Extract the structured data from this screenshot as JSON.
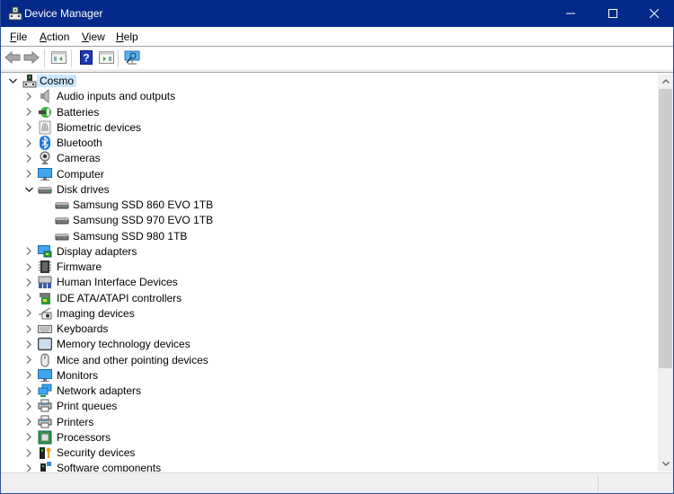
{
  "window": {
    "title": "Device Manager",
    "controls": {
      "minimize": "minimize",
      "maximize": "maximize",
      "close": "close"
    }
  },
  "menubar": {
    "items": [
      {
        "label": "File",
        "accel": "F",
        "rest": "ile"
      },
      {
        "label": "Action",
        "accel": "A",
        "rest": "ction"
      },
      {
        "label": "View",
        "accel": "V",
        "rest": "iew"
      },
      {
        "label": "Help",
        "accel": "H",
        "rest": "elp"
      }
    ]
  },
  "toolbar": {
    "buttons": [
      {
        "name": "back",
        "icon": "arrow-left-icon"
      },
      {
        "name": "forward",
        "icon": "arrow-right-icon"
      },
      {
        "name": "show-hide-console-tree",
        "icon": "console-tree-icon"
      },
      {
        "name": "help",
        "icon": "help-icon"
      },
      {
        "name": "show-hide-action-pane",
        "icon": "action-pane-icon"
      },
      {
        "name": "scan-hardware-changes",
        "icon": "scan-monitor-icon"
      }
    ]
  },
  "tree": {
    "root": {
      "label": "Cosmo",
      "expanded": true,
      "selected": true,
      "icon": "computer-tower-icon"
    },
    "categories": [
      {
        "label": "Audio inputs and outputs",
        "icon": "speaker-icon",
        "expanded": false
      },
      {
        "label": "Batteries",
        "icon": "battery-plug-icon",
        "expanded": false
      },
      {
        "label": "Biometric devices",
        "icon": "fingerprint-icon",
        "expanded": false
      },
      {
        "label": "Bluetooth",
        "icon": "bluetooth-icon",
        "expanded": false
      },
      {
        "label": "Cameras",
        "icon": "webcam-icon",
        "expanded": false
      },
      {
        "label": "Computer",
        "icon": "monitor-icon",
        "expanded": false
      },
      {
        "label": "Disk drives",
        "icon": "disk-drive-icon",
        "expanded": true,
        "children": [
          {
            "label": "Samsung SSD 860 EVO 1TB",
            "icon": "disk-drive-icon"
          },
          {
            "label": "Samsung SSD 970 EVO 1TB",
            "icon": "disk-drive-icon"
          },
          {
            "label": "Samsung SSD 980 1TB",
            "icon": "disk-drive-icon"
          }
        ]
      },
      {
        "label": "Display adapters",
        "icon": "display-adapter-icon",
        "expanded": false
      },
      {
        "label": "Firmware",
        "icon": "chip-icon",
        "expanded": false
      },
      {
        "label": "Human Interface Devices",
        "icon": "hid-icon",
        "expanded": false
      },
      {
        "label": "IDE ATA/ATAPI controllers",
        "icon": "ide-controller-icon",
        "expanded": false
      },
      {
        "label": "Imaging devices",
        "icon": "scanner-icon",
        "expanded": false
      },
      {
        "label": "Keyboards",
        "icon": "keyboard-icon",
        "expanded": false
      },
      {
        "label": "Memory technology devices",
        "icon": "memory-card-icon",
        "expanded": false
      },
      {
        "label": "Mice and other pointing devices",
        "icon": "mouse-icon",
        "expanded": false
      },
      {
        "label": "Monitors",
        "icon": "monitor-icon",
        "expanded": false
      },
      {
        "label": "Network adapters",
        "icon": "network-icon",
        "expanded": false
      },
      {
        "label": "Print queues",
        "icon": "printer-icon",
        "expanded": false
      },
      {
        "label": "Printers",
        "icon": "printer-icon",
        "expanded": false
      },
      {
        "label": "Processors",
        "icon": "processor-icon",
        "expanded": false
      },
      {
        "label": "Security devices",
        "icon": "security-key-icon",
        "expanded": false
      },
      {
        "label": "Software components",
        "icon": "software-component-icon",
        "expanded": false
      }
    ]
  },
  "colors": {
    "titlebar": "#032a8a",
    "selection": "#cce8ff",
    "scroll_thumb": "#cdcdcd"
  },
  "scrollbar": {
    "vertical_position": 0,
    "visible_fraction": 0.76
  }
}
